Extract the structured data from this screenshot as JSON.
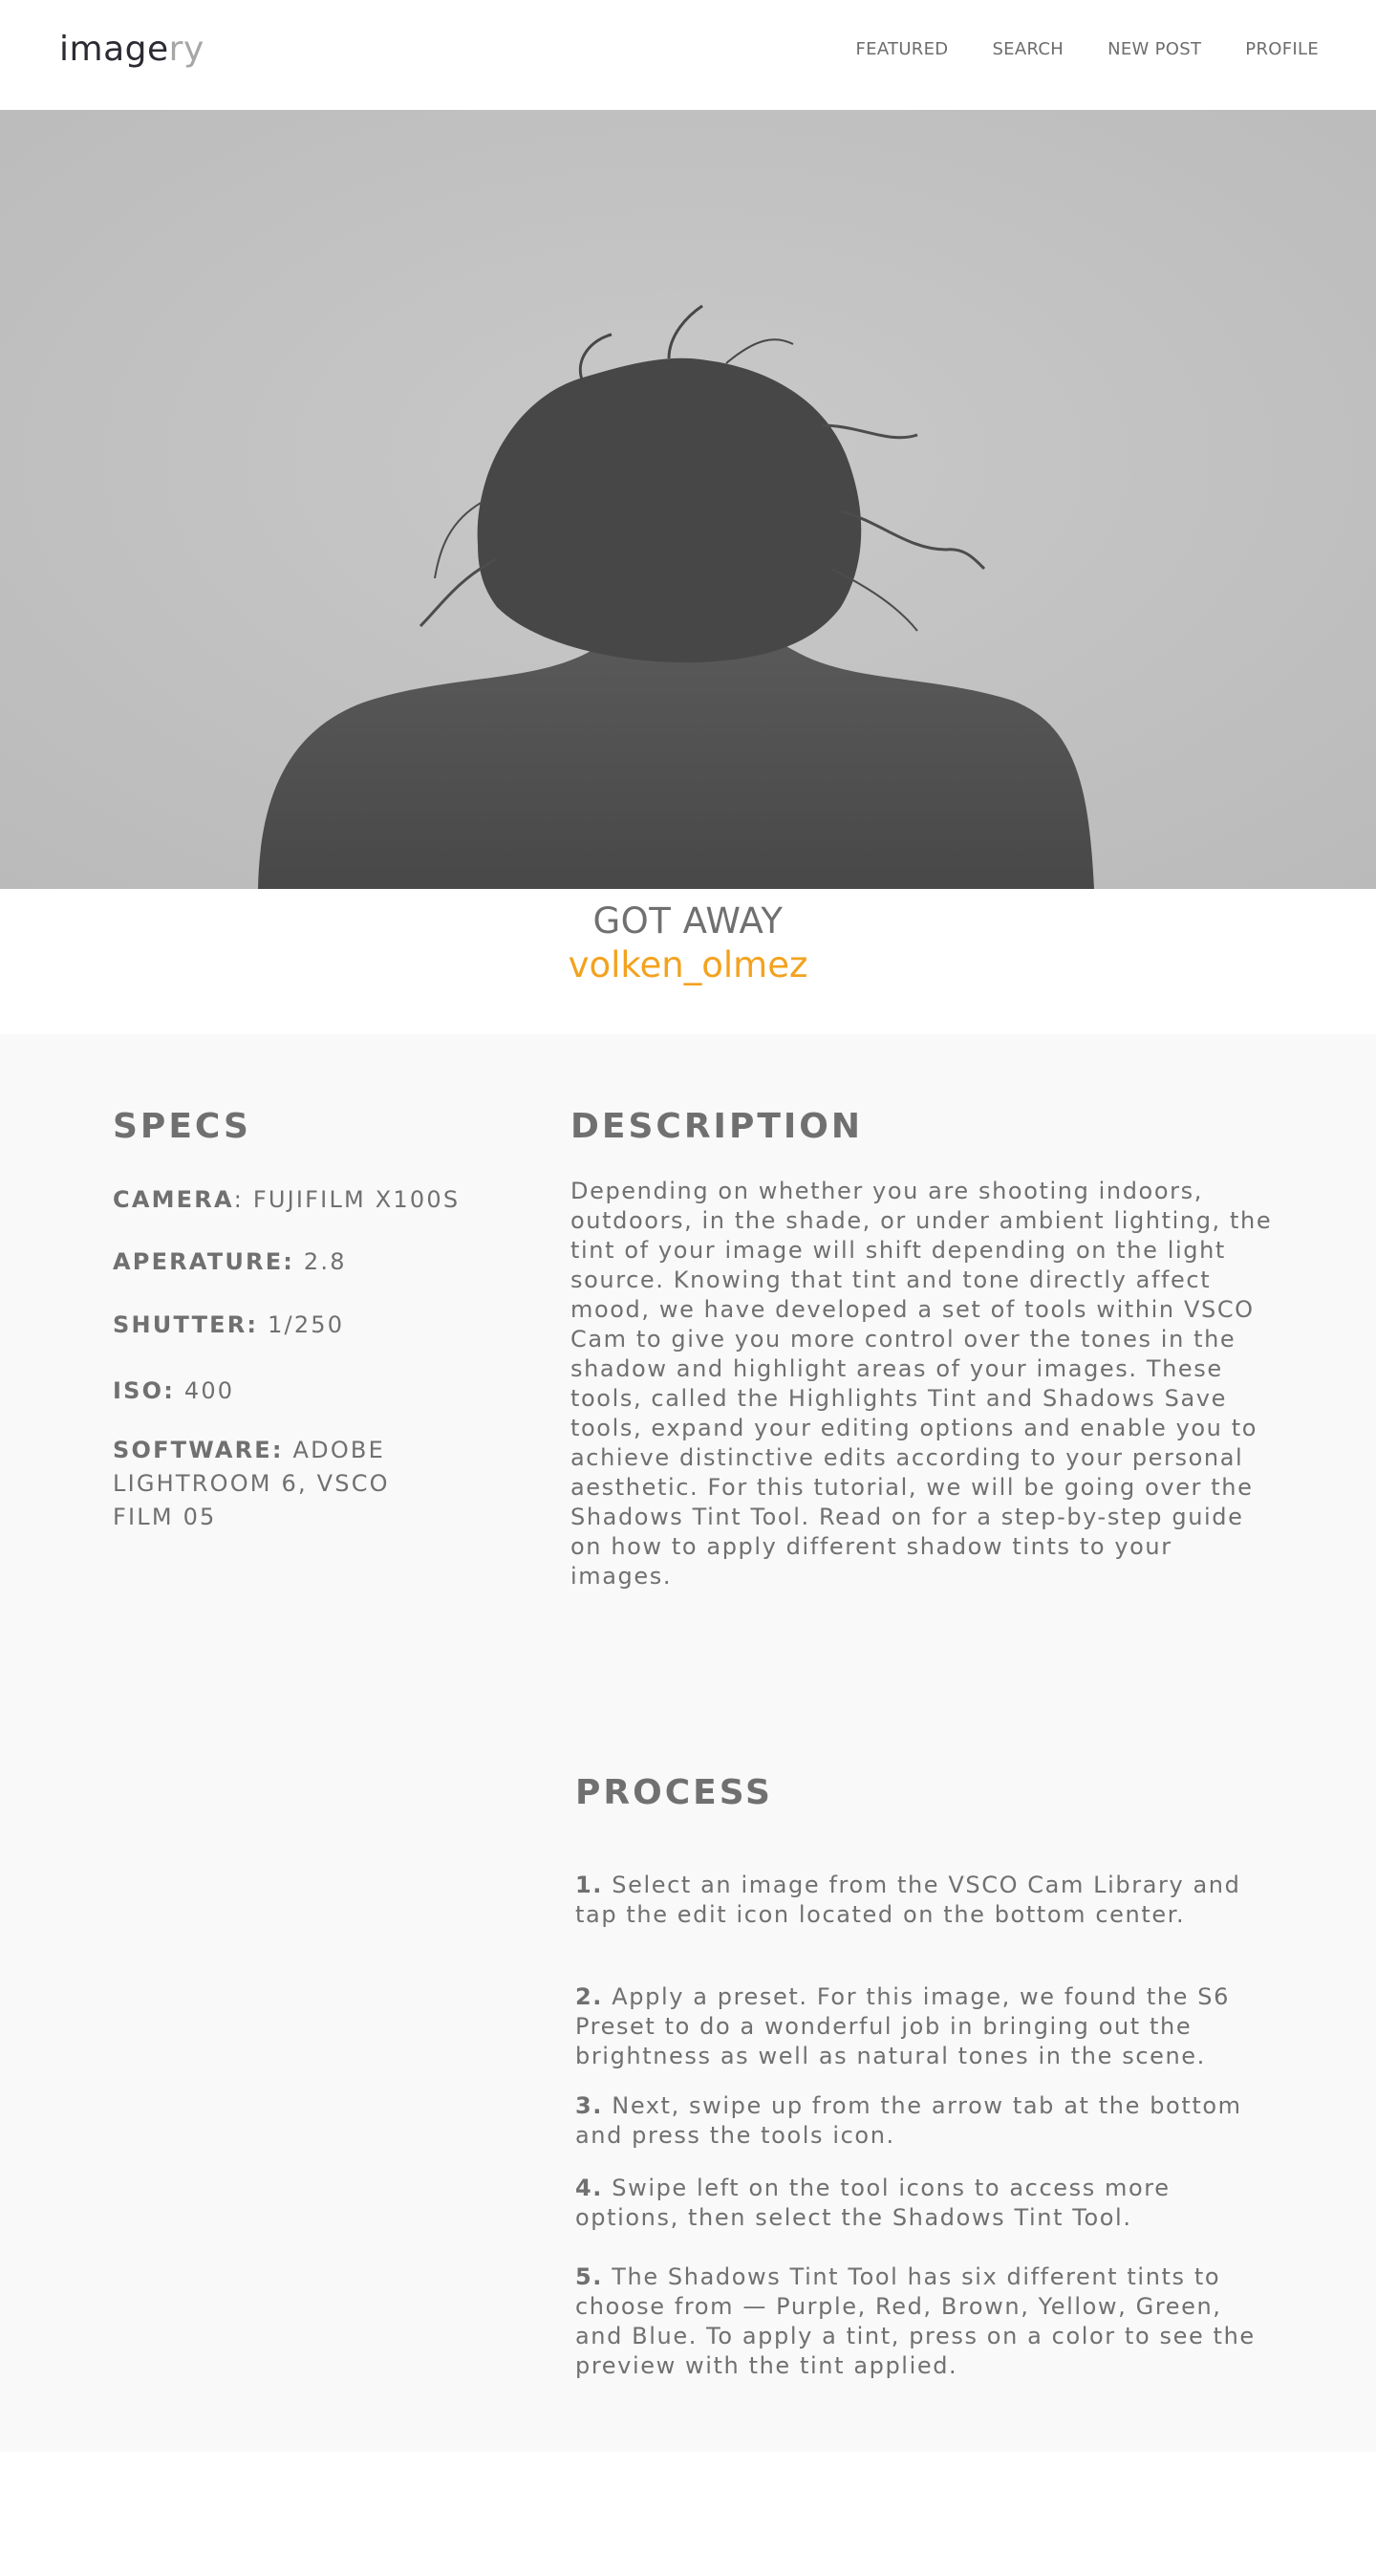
{
  "header": {
    "logo": {
      "dark": "image",
      "light": "ry"
    },
    "nav": [
      {
        "label": "FEATURED"
      },
      {
        "label": "SEARCH"
      },
      {
        "label": "NEW POST"
      },
      {
        "label": "PROFILE"
      }
    ]
  },
  "post": {
    "title": "GOT AWAY",
    "author": "volken_olmez"
  },
  "specs": {
    "heading": "SPECS",
    "camera": {
      "label": "CAMERA",
      "value": ": FUJIFILM X100S"
    },
    "aperture": {
      "label": "APERATURE:",
      "value": " 2.8"
    },
    "shutter": {
      "label": "SHUTTER:",
      "value": " 1/250"
    },
    "iso": {
      "label": "ISO:",
      "value": " 400"
    },
    "software": {
      "label": "SOFTWARE:",
      "value": " ADOBE LIGHTROOM 6, VSCO FILM 05"
    }
  },
  "description": {
    "heading": "DESCRIPTION",
    "text": "Depending on whether you are shooting indoors, outdoors, in the shade, or under ambient lighting, the tint of your image will shift depending on the light source. Knowing that tint and tone directly affect mood, we have developed a set of tools within VSCO Cam to give you more control over the tones in the shadow and highlight areas of your images. These tools, called the Highlights Tint and Shadows Save tools, expand your editing options and enable you to achieve distinctive edits according to your personal aesthetic. For this tutorial, we will be going over the Shadows Tint Tool. Read on for a step-by-step guide on how to apply different shadow tints to your images."
  },
  "process": {
    "heading": "PROCESS",
    "steps": [
      {
        "num": "1.",
        "text": " Select an image from the VSCO Cam Library and tap the edit icon located on the bottom center."
      },
      {
        "num": "2.",
        "text": " Apply a preset. For this image, we found the S6 Preset to do a wonderful job in bringing out the brightness as well as natural tones in the scene."
      },
      {
        "num": "3.",
        "text": " Next, swipe up from the arrow tab at the bottom and press the tools icon."
      },
      {
        "num": "4.",
        "text": " Swipe left on the tool icons to access more options, then select the Shadows Tint Tool."
      },
      {
        "num": "5.",
        "text": " The Shadows Tint Tool has six different tints to choose from — Purple, Red, Brown, Yellow, Green, and Blue. To apply a tint, press on a color to see the preview with the tint applied."
      }
    ]
  },
  "colors": {
    "accent": "#f3a21f",
    "text": "#707070",
    "content_bg": "#f9f9f9"
  }
}
